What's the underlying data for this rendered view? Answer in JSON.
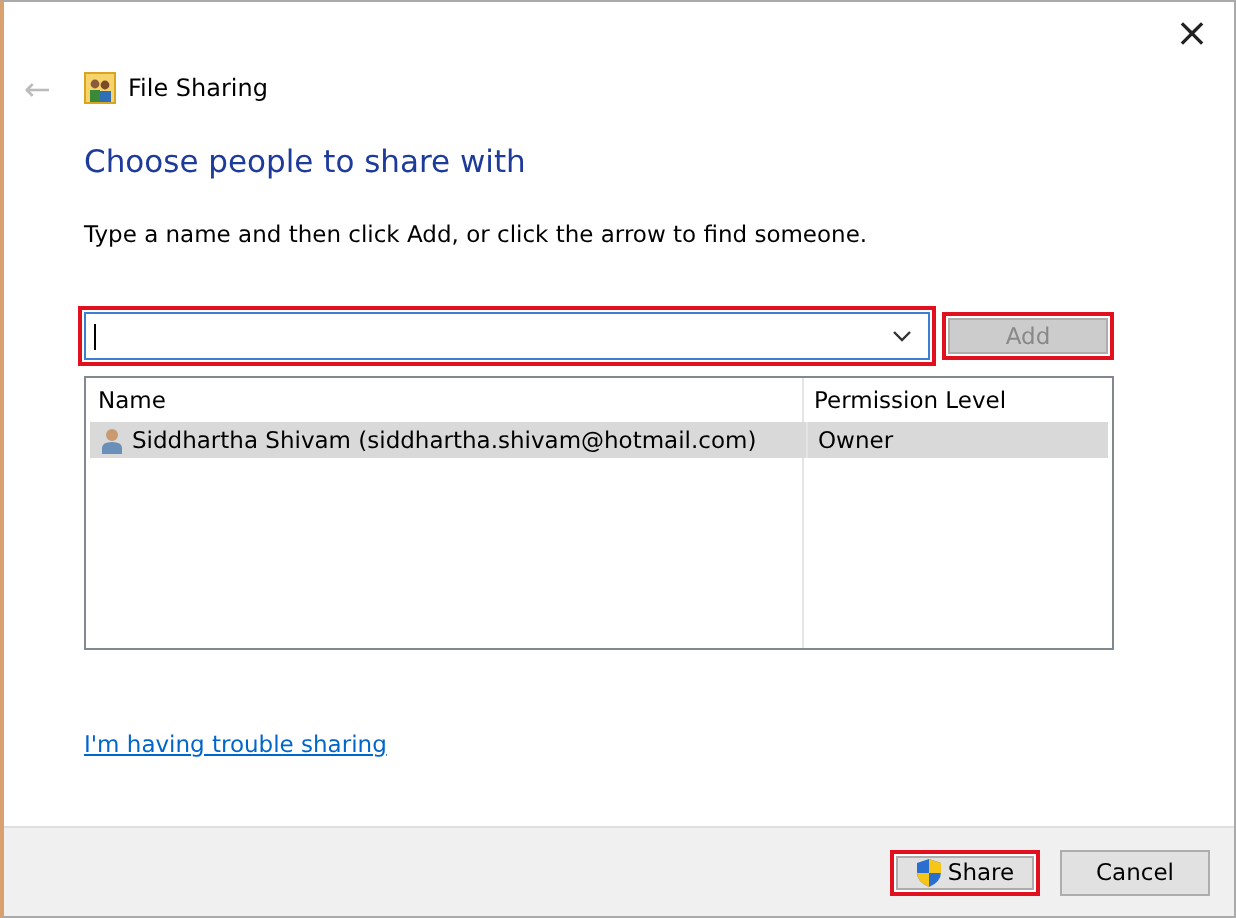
{
  "window": {
    "title": "File Sharing",
    "close": "×",
    "back": "←"
  },
  "heading": "Choose people to share with",
  "instruction": "Type a name and then click Add, or click the arrow to find someone.",
  "name_field": {
    "highlighted": true
  },
  "add_button": {
    "label": "Add",
    "disabled": true,
    "highlighted": true
  },
  "table": {
    "columns": [
      "Name",
      "Permission Level"
    ],
    "rows": [
      {
        "name": "Siddhartha Shivam (siddhartha.shivam@hotmail.com)",
        "permission": "Owner",
        "selected": true
      }
    ]
  },
  "help_link": "I'm having trouble sharing",
  "buttons": [
    {
      "kind": "shield",
      "label": "Share",
      "highlighted": true
    },
    {
      "kind": "plain",
      "label": "Cancel",
      "highlighted": false
    }
  ]
}
